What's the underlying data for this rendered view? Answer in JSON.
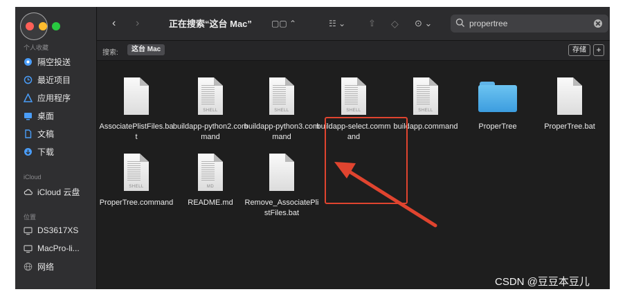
{
  "toolbar": {
    "back": "‹",
    "forward": "›",
    "title": "正在搜索“这台 Mac”",
    "view_toggle": "▢▢ ⌃",
    "group_toggle": "☷ ⌄",
    "share": "⇧",
    "tag": "◇",
    "more": "⊙ ⌄",
    "search_value": "propertree"
  },
  "scopebar": {
    "label": "搜索:",
    "scope": "这台 Mac",
    "save": "存储",
    "add": "+"
  },
  "sidebar": {
    "favorites_title": "个人收藏",
    "favorites": [
      {
        "label": "隔空投送",
        "icon": "airdrop-icon"
      },
      {
        "label": "最近项目",
        "icon": "clock-icon"
      },
      {
        "label": "应用程序",
        "icon": "apps-icon"
      },
      {
        "label": "桌面",
        "icon": "desktop-icon"
      },
      {
        "label": "文稿",
        "icon": "document-icon"
      },
      {
        "label": "下载",
        "icon": "download-icon"
      }
    ],
    "icloud_title": "iCloud",
    "icloud": [
      {
        "label": "iCloud 云盘",
        "icon": "cloud-icon"
      }
    ],
    "locations_title": "位置",
    "locations": [
      {
        "label": "DS3617XS",
        "icon": "monitor-icon"
      },
      {
        "label": "MacPro-li...",
        "icon": "monitor-icon"
      },
      {
        "label": "网络",
        "icon": "globe-icon"
      }
    ]
  },
  "files": [
    {
      "name": "AssociatePlistFiles.bat",
      "tag": ""
    },
    {
      "name": "buildapp-python2.command",
      "tag": "SHELL"
    },
    {
      "name": "buildapp-python3.command",
      "tag": "SHELL"
    },
    {
      "name": "buildapp-select.command",
      "tag": "SHELL"
    },
    {
      "name": "buildapp.command",
      "tag": "SHELL"
    },
    {
      "name": "ProperTree",
      "tag": ""
    },
    {
      "name": "ProperTree.bat",
      "tag": ""
    },
    {
      "name": "ProperTree.command",
      "tag": "SHELL"
    },
    {
      "name": "README.md",
      "tag": "MD"
    },
    {
      "name": "Remove_AssociatePlistFiles.bat",
      "tag": ""
    }
  ],
  "watermark": "CSDN @豆豆本豆儿",
  "colors": {
    "highlight": "#e0442f",
    "arrow": "#e0442f",
    "folder": "#4ab0ea",
    "window_bg": "#1e1e1e",
    "sidebar_bg": "#2f2f31"
  }
}
